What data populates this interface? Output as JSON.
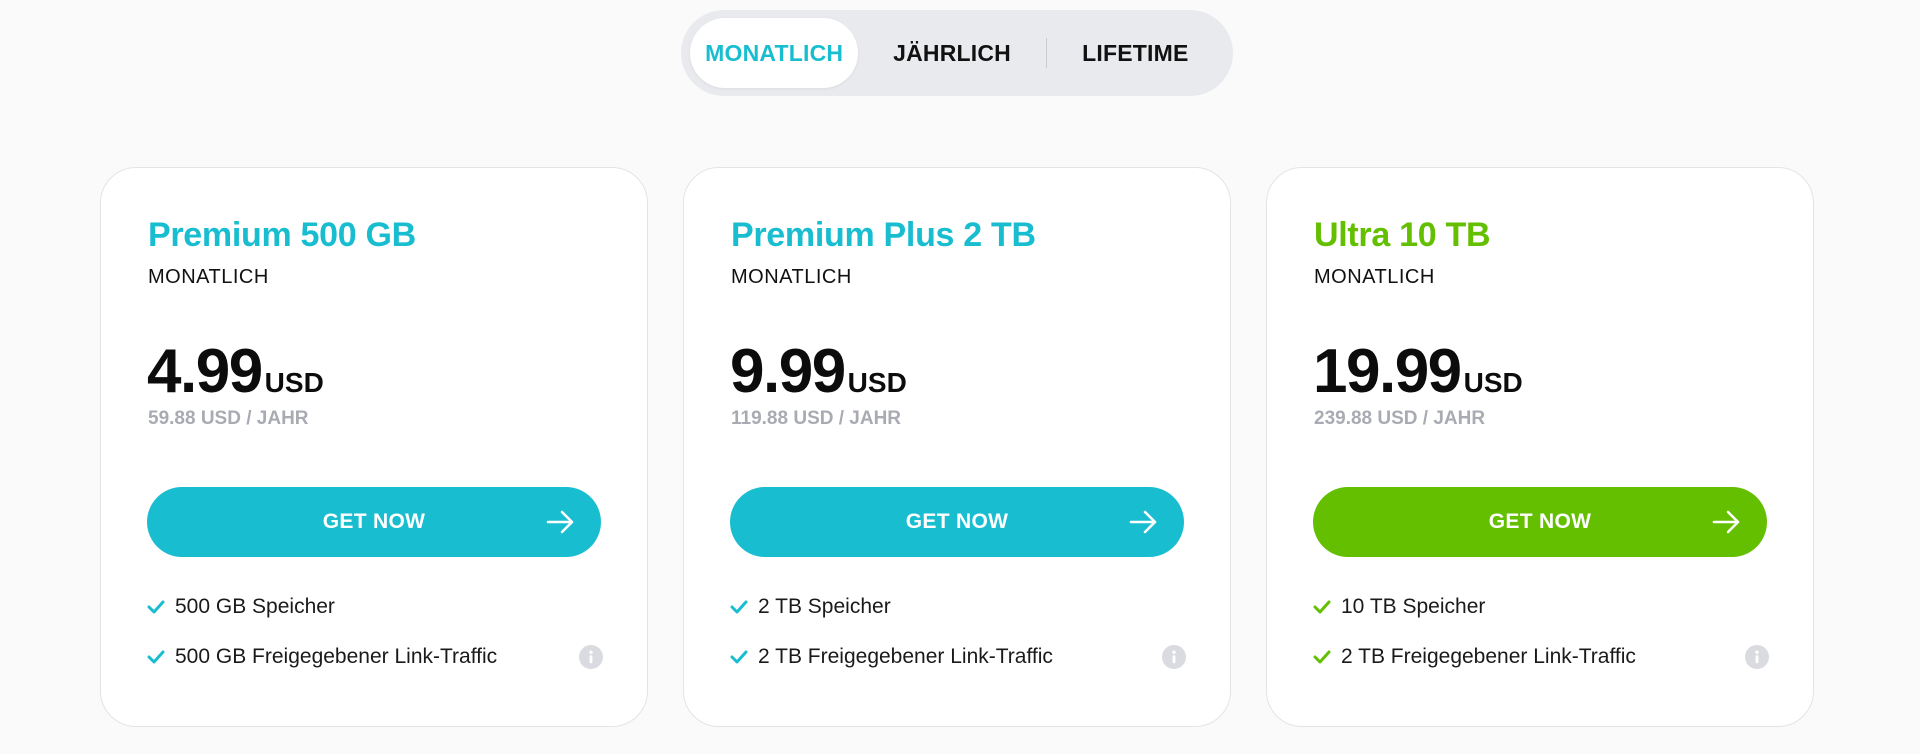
{
  "colors": {
    "teal": "#18bdd0",
    "green": "#63bf00",
    "year_gray": "#a8abb2"
  },
  "billing_tabs": [
    {
      "label": "MONATLICH",
      "active": true
    },
    {
      "label": "JÄHRLICH",
      "active": false
    },
    {
      "label": "LIFETIME",
      "active": false
    }
  ],
  "plans": [
    {
      "name": "Premium 500 GB",
      "period": "MONATLICH",
      "price": "4.99",
      "currency": "USD",
      "yearly": "59.88 USD / JAHR",
      "cta_label": "GET NOW",
      "accent": "#18bdd0",
      "features": [
        "500 GB Speicher",
        "500 GB Freigegebener Link-Traffic"
      ]
    },
    {
      "name": "Premium Plus 2 TB",
      "period": "MONATLICH",
      "price": "9.99",
      "currency": "USD",
      "yearly": "119.88 USD / JAHR",
      "cta_label": "GET NOW",
      "accent": "#18bdd0",
      "features": [
        "2 TB Speicher",
        "2 TB Freigegebener Link-Traffic"
      ]
    },
    {
      "name": "Ultra 10 TB",
      "period": "MONATLICH",
      "price": "19.99",
      "currency": "USD",
      "yearly": "239.88 USD / JAHR",
      "cta_label": "GET NOW",
      "accent": "#63bf00",
      "features": [
        "10 TB Speicher",
        "2 TB Freigegebener Link-Traffic"
      ]
    }
  ],
  "icons": {
    "cta": "arrow-right-icon",
    "feature": "check-icon",
    "info": "info-icon"
  }
}
